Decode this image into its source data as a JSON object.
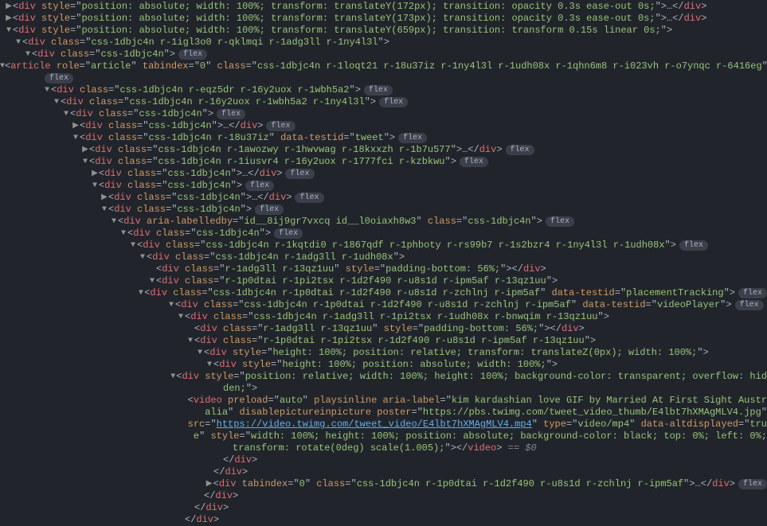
{
  "badge_label": "flex",
  "ellipsis": "…",
  "shadow_text": " == $0",
  "arrows": {
    "right": "▶",
    "down": "▼"
  },
  "lines": [
    {
      "indent": 0,
      "arrow": "right",
      "html": "<span class='punc'>&lt;</span><span class='tag'>div</span> <span class='attrname'>style</span><span class='punc'>=</span><span class='punc'>\"</span><span class='attrval'>position: absolute; width: 100%; transform: translateY(172px); transition: opacity 0.3s ease-out 0s;</span><span class='punc'>\"</span><span class='punc'>&gt;</span><span class='ellipsis'>…</span><span class='punc'>&lt;/</span><span class='tag'>div</span><span class='punc'>&gt;</span>",
      "flex": false
    },
    {
      "indent": 0,
      "arrow": "right",
      "html": "<span class='punc'>&lt;</span><span class='tag'>div</span> <span class='attrname'>style</span><span class='punc'>=</span><span class='punc'>\"</span><span class='attrval'>position: absolute; width: 100%; transform: translateY(173px); transition: opacity 0.3s ease-out 0s;</span><span class='punc'>\"</span><span class='punc'>&gt;</span><span class='ellipsis'>…</span><span class='punc'>&lt;/</span><span class='tag'>div</span><span class='punc'>&gt;</span>",
      "flex": false
    },
    {
      "indent": 0,
      "arrow": "down",
      "html": "<span class='punc'>&lt;</span><span class='tag'>div</span> <span class='attrname'>style</span><span class='punc'>=</span><span class='punc'>\"</span><span class='attrval'>position: absolute; width: 100%; transform: translateY(659px); transition: transform 0.15s linear 0s;</span><span class='punc'>\"</span><span class='punc'>&gt;</span>",
      "flex": false
    },
    {
      "indent": 1,
      "arrow": "down",
      "html": "<span class='punc'>&lt;</span><span class='tag'>div</span> <span class='attrname'>class</span><span class='punc'>=</span><span class='punc'>\"</span><span class='attrval'>css-1dbjc4n r-1igl3o0 r-qklmqi r-1adg3ll r-1ny4l3l</span><span class='punc'>\"</span><span class='punc'>&gt;</span>",
      "flex": false
    },
    {
      "indent": 2,
      "arrow": "down",
      "html": "<span class='punc'>&lt;</span><span class='tag'>div</span> <span class='attrname'>class</span><span class='punc'>=</span><span class='punc'>\"</span><span class='attrval'>css-1dbjc4n</span><span class='punc'>\"</span><span class='punc'>&gt;</span>",
      "flex": true
    },
    {
      "indent": 3,
      "arrow": "down",
      "html": "<span class='punc'>&lt;</span><span class='tag'>article</span> <span class='attrname'>role</span><span class='punc'>=</span><span class='punc'>\"</span><span class='attrval'>article</span><span class='punc'>\"</span> <span class='attrname'>tabindex</span><span class='punc'>=</span><span class='punc'>\"</span><span class='attrval'>0</span><span class='punc'>\"</span> <span class='attrname'>class</span><span class='punc'>=</span><span class='punc'>\"</span><span class='attrval'>css-1dbjc4n r-1loqt21 r-18u37iz r-1ny4l3l r-1udh08x r-1qhn6m8 r-i023vh r-o7ynqc r-6416eg</span><span class='punc'>\"</span><span class='punc'>&gt;</span>",
      "flex": true,
      "flexbelow": true
    },
    {
      "indent": 4,
      "arrow": "down",
      "html": "<span class='punc'>&lt;</span><span class='tag'>div</span> <span class='attrname'>class</span><span class='punc'>=</span><span class='punc'>\"</span><span class='attrval'>css-1dbjc4n r-eqz5dr r-16y2uox r-1wbh5a2</span><span class='punc'>\"</span><span class='punc'>&gt;</span>",
      "flex": true
    },
    {
      "indent": 5,
      "arrow": "down",
      "html": "<span class='punc'>&lt;</span><span class='tag'>div</span> <span class='attrname'>class</span><span class='punc'>=</span><span class='punc'>\"</span><span class='attrval'>css-1dbjc4n r-16y2uox r-1wbh5a2 r-1ny4l3l</span><span class='punc'>\"</span><span class='punc'>&gt;</span>",
      "flex": true
    },
    {
      "indent": 6,
      "arrow": "down",
      "html": "<span class='punc'>&lt;</span><span class='tag'>div</span> <span class='attrname'>class</span><span class='punc'>=</span><span class='punc'>\"</span><span class='attrval'>css-1dbjc4n</span><span class='punc'>\"</span><span class='punc'>&gt;</span>",
      "flex": true
    },
    {
      "indent": 7,
      "arrow": "right",
      "html": "<span class='punc'>&lt;</span><span class='tag'>div</span> <span class='attrname'>class</span><span class='punc'>=</span><span class='punc'>\"</span><span class='attrval'>css-1dbjc4n</span><span class='punc'>\"</span><span class='punc'>&gt;</span><span class='ellipsis'>…</span><span class='punc'>&lt;/</span><span class='tag'>div</span><span class='punc'>&gt;</span>",
      "flex": true
    },
    {
      "indent": 7,
      "arrow": "down",
      "html": "<span class='punc'>&lt;</span><span class='tag'>div</span> <span class='attrname'>class</span><span class='punc'>=</span><span class='punc'>\"</span><span class='attrval'>css-1dbjc4n r-18u37iz</span><span class='punc'>\"</span> <span class='attrname'>data-testid</span><span class='punc'>=</span><span class='punc'>\"</span><span class='attrval'>tweet</span><span class='punc'>\"</span><span class='punc'>&gt;</span>",
      "flex": true
    },
    {
      "indent": 8,
      "arrow": "right",
      "html": "<span class='punc'>&lt;</span><span class='tag'>div</span> <span class='attrname'>class</span><span class='punc'>=</span><span class='punc'>\"</span><span class='attrval'>css-1dbjc4n r-1awozwy r-1hwvwag r-18kxxzh r-1b7u577</span><span class='punc'>\"</span><span class='punc'>&gt;</span><span class='ellipsis'>…</span><span class='punc'>&lt;/</span><span class='tag'>div</span><span class='punc'>&gt;</span>",
      "flex": true
    },
    {
      "indent": 8,
      "arrow": "down",
      "html": "<span class='punc'>&lt;</span><span class='tag'>div</span> <span class='attrname'>class</span><span class='punc'>=</span><span class='punc'>\"</span><span class='attrval'>css-1dbjc4n r-1iusvr4 r-16y2uox r-1777fci r-kzbkwu</span><span class='punc'>\"</span><span class='punc'>&gt;</span>",
      "flex": true
    },
    {
      "indent": 9,
      "arrow": "right",
      "html": "<span class='punc'>&lt;</span><span class='tag'>div</span> <span class='attrname'>class</span><span class='punc'>=</span><span class='punc'>\"</span><span class='attrval'>css-1dbjc4n</span><span class='punc'>\"</span><span class='punc'>&gt;</span><span class='ellipsis'>…</span><span class='punc'>&lt;/</span><span class='tag'>div</span><span class='punc'>&gt;</span>",
      "flex": true
    },
    {
      "indent": 9,
      "arrow": "down",
      "html": "<span class='punc'>&lt;</span><span class='tag'>div</span> <span class='attrname'>class</span><span class='punc'>=</span><span class='punc'>\"</span><span class='attrval'>css-1dbjc4n</span><span class='punc'>\"</span><span class='punc'>&gt;</span>",
      "flex": true
    },
    {
      "indent": 10,
      "arrow": "right",
      "html": "<span class='punc'>&lt;</span><span class='tag'>div</span> <span class='attrname'>class</span><span class='punc'>=</span><span class='punc'>\"</span><span class='attrval'>css-1dbjc4n</span><span class='punc'>\"</span><span class='punc'>&gt;</span><span class='ellipsis'>…</span><span class='punc'>&lt;/</span><span class='tag'>div</span><span class='punc'>&gt;</span>",
      "flex": true
    },
    {
      "indent": 10,
      "arrow": "down",
      "html": "<span class='punc'>&lt;</span><span class='tag'>div</span> <span class='attrname'>class</span><span class='punc'>=</span><span class='punc'>\"</span><span class='attrval'>css-1dbjc4n</span><span class='punc'>\"</span><span class='punc'>&gt;</span>",
      "flex": true
    },
    {
      "indent": 11,
      "arrow": "down",
      "html": "<span class='punc'>&lt;</span><span class='tag'>div</span> <span class='attrname'>aria-labelledby</span><span class='punc'>=</span><span class='punc'>\"</span><span class='attrval'>id__8ij9gr7vxcq id__l0oiaxh8w3</span><span class='punc'>\"</span> <span class='attrname'>class</span><span class='punc'>=</span><span class='punc'>\"</span><span class='attrval'>css-1dbjc4n</span><span class='punc'>\"</span><span class='punc'>&gt;</span>",
      "flex": true
    },
    {
      "indent": 12,
      "arrow": "down",
      "html": "<span class='punc'>&lt;</span><span class='tag'>div</span> <span class='attrname'>class</span><span class='punc'>=</span><span class='punc'>\"</span><span class='attrval'>css-1dbjc4n</span><span class='punc'>\"</span><span class='punc'>&gt;</span>",
      "flex": true
    },
    {
      "indent": 13,
      "arrow": "down",
      "html": "<span class='punc'>&lt;</span><span class='tag'>div</span> <span class='attrname'>class</span><span class='punc'>=</span><span class='punc'>\"</span><span class='attrval'>css-1dbjc4n r-1kqtdi0 r-1867qdf r-1phboty r-rs99b7 r-1s2bzr4 r-1ny4l3l r-1udh08x</span><span class='punc'>\"</span><span class='punc'>&gt;</span>",
      "flex": true
    },
    {
      "indent": 14,
      "arrow": "down",
      "html": "<span class='punc'>&lt;</span><span class='tag'>div</span> <span class='attrname'>class</span><span class='punc'>=</span><span class='punc'>\"</span><span class='attrval'>css-1dbjc4n r-1adg3ll r-1udh08x</span><span class='punc'>\"</span><span class='punc'>&gt;</span>",
      "flex": false
    },
    {
      "indent": 15,
      "arrow": "",
      "html": "<span class='punc'>&lt;</span><span class='tag'>div</span> <span class='attrname'>class</span><span class='punc'>=</span><span class='punc'>\"</span><span class='attrval'>r-1adg3ll r-13qz1uu</span><span class='punc'>\"</span> <span class='attrname'>style</span><span class='punc'>=</span><span class='punc'>\"</span><span class='attrval'>padding-bottom: 56%;</span><span class='punc'>\"</span><span class='punc'>&gt;&lt;/</span><span class='tag'>div</span><span class='punc'>&gt;</span>",
      "flex": false
    },
    {
      "indent": 15,
      "arrow": "down",
      "html": "<span class='punc'>&lt;</span><span class='tag'>div</span> <span class='attrname'>class</span><span class='punc'>=</span><span class='punc'>\"</span><span class='attrval'>r-1p0dtai r-1pi2tsx r-1d2f490 r-u8s1d r-ipm5af r-13qz1uu</span><span class='punc'>\"</span><span class='punc'>&gt;</span>",
      "flex": false
    },
    {
      "indent": 16,
      "arrow": "down",
      "html": "<span class='punc'>&lt;</span><span class='tag'>div</span> <span class='attrname'>class</span><span class='punc'>=</span><span class='punc'>\"</span><span class='attrval'>css-1dbjc4n r-1p0dtai r-1d2f490 r-u8s1d r-zchlnj r-ipm5af</span><span class='punc'>\"</span> <span class='attrname'>data-testid</span><span class='punc'>=</span><span class='punc'>\"</span><span class='attrval'>placementTracking</span><span class='punc'>\"</span><span class='punc'>&gt;</span>",
      "flex": true
    },
    {
      "indent": 17,
      "arrow": "down",
      "html": "<span class='punc'>&lt;</span><span class='tag'>div</span> <span class='attrname'>class</span><span class='punc'>=</span><span class='punc'>\"</span><span class='attrval'>css-1dbjc4n r-1p0dtai r-1d2f490 r-u8s1d r-zchlnj r-ipm5af</span><span class='punc'>\"</span> <span class='attrname'>data-testid</span><span class='punc'>=</span><span class='punc'>\"</span><span class='attrval'>videoPlayer</span><span class='punc'>\"</span><span class='punc'>&gt;</span>",
      "flex": true
    },
    {
      "indent": 18,
      "arrow": "down",
      "html": "<span class='punc'>&lt;</span><span class='tag'>div</span> <span class='attrname'>class</span><span class='punc'>=</span><span class='punc'>\"</span><span class='attrval'>css-1dbjc4n r-1adg3ll r-1pi2tsx r-1udh08x r-bnwqim r-13qz1uu</span><span class='punc'>\"</span><span class='punc'>&gt;</span>",
      "flex": false
    },
    {
      "indent": 19,
      "arrow": "",
      "html": "<span class='punc'>&lt;</span><span class='tag'>div</span> <span class='attrname'>class</span><span class='punc'>=</span><span class='punc'>\"</span><span class='attrval'>r-1adg3ll r-13qz1uu</span><span class='punc'>\"</span> <span class='attrname'>style</span><span class='punc'>=</span><span class='punc'>\"</span><span class='attrval'>padding-bottom: 56%;</span><span class='punc'>\"</span><span class='punc'>&gt;&lt;/</span><span class='tag'>div</span><span class='punc'>&gt;</span>",
      "flex": false
    },
    {
      "indent": 19,
      "arrow": "down",
      "html": "<span class='punc'>&lt;</span><span class='tag'>div</span> <span class='attrname'>class</span><span class='punc'>=</span><span class='punc'>\"</span><span class='attrval'>r-1p0dtai r-1pi2tsx r-1d2f490 r-u8s1d r-ipm5af r-13qz1uu</span><span class='punc'>\"</span><span class='punc'>&gt;</span>",
      "flex": false
    },
    {
      "indent": 20,
      "arrow": "down",
      "html": "<span class='punc'>&lt;</span><span class='tag'>div</span> <span class='attrname'>style</span><span class='punc'>=</span><span class='punc'>\"</span><span class='attrval'>height: 100%; position: relative; transform: translateZ(0px); width: 100%;</span><span class='punc'>\"</span><span class='punc'>&gt;</span>",
      "flex": false
    },
    {
      "indent": 21,
      "arrow": "down",
      "html": "<span class='punc'>&lt;</span><span class='tag'>div</span> <span class='attrname'>style</span><span class='punc'>=</span><span class='punc'>\"</span><span class='attrval'>height: 100%; position: absolute; width: 100%;</span><span class='punc'>\"</span><span class='punc'>&gt;</span>",
      "flex": false
    },
    {
      "indent": 22,
      "arrow": "down",
      "html": "<span class='punc'>&lt;</span><span class='tag'>div</span> <span class='attrname'>style</span><span class='punc'>=</span><span class='punc'>\"</span><span class='attrval'>position: relative; width: 100%; height: 100%; background-color: transparent; overflow: hid</span>",
      "flex": false
    },
    {
      "indent": 22,
      "arrow": "",
      "cont": true,
      "html": "<span class='attrval'>den;</span><span class='punc'>\"</span><span class='punc'>&gt;</span>",
      "flex": false
    },
    {
      "indent": 23,
      "arrow": "",
      "html": "<span class='punc'>&lt;</span><span class='tag'>video</span> <span class='attrname'>preload</span><span class='punc'>=</span><span class='punc'>\"</span><span class='attrval'>auto</span><span class='punc'>\"</span> <span class='attrname'>playsinline</span> <span class='attrname'>aria-label</span><span class='punc'>=</span><span class='punc'>\"</span><span class='attrval'>kim kardashian love GIF by Married At First Sight Austr</span>",
      "flex": false
    },
    {
      "indent": 23,
      "arrow": "",
      "cont": true,
      "html": "<span class='attrval'>alia</span><span class='punc'>\"</span> <span class='attrname'>disablepictureinpicture</span> <span class='attrname'>poster</span><span class='punc'>=</span><span class='punc'>\"</span><span class='attrval'>https://pbs.twimg.com/tweet_video_thumb/E4lbt7hXMAgMLV4.jpg</span><span class='punc'>\"</span>",
      "flex": false
    },
    {
      "indent": 23,
      "arrow": "",
      "cont": true,
      "html": "<span class='attrname'>src</span><span class='punc'>=</span><span class='punc'>\"</span><span class='link'>https://video.twimg.com/tweet_video/E4lbt7hXMAgMLV4.mp4</span><span class='punc'>\"</span> <span class='attrname'>type</span><span class='punc'>=</span><span class='punc'>\"</span><span class='attrval'>video/mp4</span><span class='punc'>\"</span> <span class='attrname'>data-altdisplayed</span><span class='punc'>=</span><span class='punc'>\"</span><span class='attrval'>tru</span>",
      "flex": false
    },
    {
      "indent": 23,
      "arrow": "",
      "cont": true,
      "html": "<span class='attrval'>e</span><span class='punc'>\"</span> <span class='attrname'>style</span><span class='punc'>=</span><span class='punc'>\"</span><span class='attrval'>width: 100%; height: 100%; position: absolute; background-color: black; top: 0%; left: 0%;</span>",
      "flex": false
    },
    {
      "indent": 23,
      "arrow": "",
      "cont": true,
      "html": "<span class='attrval'>transform: rotate(0deg) scale(1.005);</span><span class='punc'>\"</span><span class='punc'>&gt;&lt;/</span><span class='tag'>video</span><span class='punc'>&gt;</span><span class='shadow'> == $0</span>",
      "flex": false
    },
    {
      "indent": 22,
      "arrow": "",
      "html": "<span class='punc'>&lt;/</span><span class='tag'>div</span><span class='punc'>&gt;</span>",
      "flex": false
    },
    {
      "indent": 21,
      "arrow": "",
      "html": "<span class='punc'>&lt;/</span><span class='tag'>div</span><span class='punc'>&gt;</span>",
      "flex": false
    },
    {
      "indent": 21,
      "arrow": "right",
      "html": "<span class='punc'>&lt;</span><span class='tag'>div</span> <span class='attrname'>tabindex</span><span class='punc'>=</span><span class='punc'>\"</span><span class='attrval'>0</span><span class='punc'>\"</span> <span class='attrname'>class</span><span class='punc'>=</span><span class='punc'>\"</span><span class='attrval'>css-1dbjc4n r-1p0dtai r-1d2f490 r-u8s1d r-zchlnj r-ipm5af</span><span class='punc'>\"</span><span class='punc'>&gt;</span><span class='ellipsis'>…</span><span class='punc'>&lt;/</span><span class='tag'>div</span><span class='punc'>&gt;</span>",
      "flex": true
    },
    {
      "indent": 20,
      "arrow": "",
      "html": "<span class='punc'>&lt;/</span><span class='tag'>div</span><span class='punc'>&gt;</span>",
      "flex": false
    },
    {
      "indent": 19,
      "arrow": "",
      "html": "<span class='punc'>&lt;/</span><span class='tag'>div</span><span class='punc'>&gt;</span>",
      "flex": false
    },
    {
      "indent": 18,
      "arrow": "",
      "html": "<span class='punc'>&lt;/</span><span class='tag'>div</span><span class='punc'>&gt;</span>",
      "flex": false
    }
  ]
}
